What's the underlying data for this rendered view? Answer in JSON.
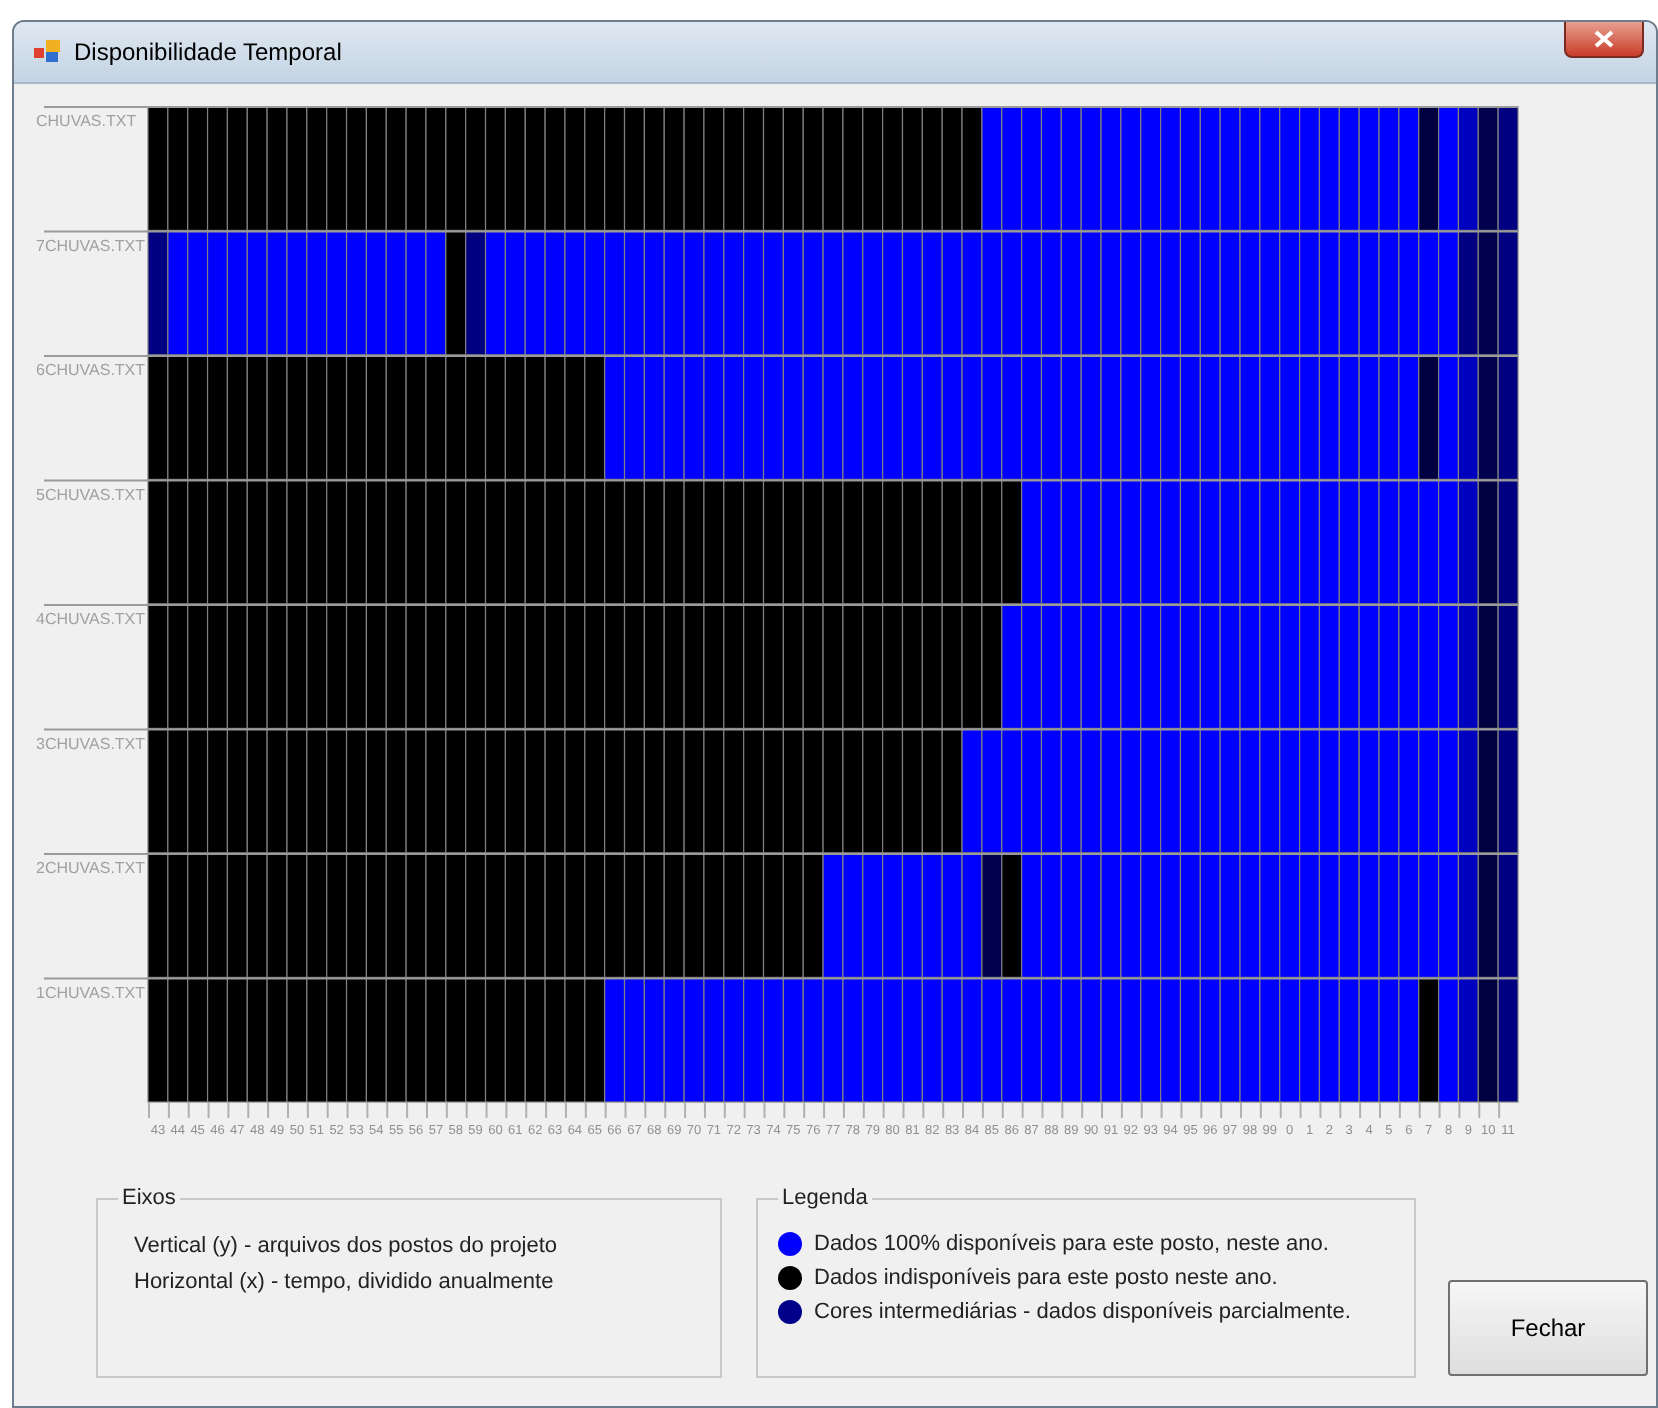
{
  "window": {
    "title": "Disponibilidade Temporal"
  },
  "grid": {
    "year_labels": [
      "43",
      "44",
      "45",
      "46",
      "47",
      "48",
      "49",
      "50",
      "51",
      "52",
      "53",
      "54",
      "55",
      "56",
      "57",
      "58",
      "59",
      "60",
      "61",
      "62",
      "63",
      "64",
      "65",
      "66",
      "67",
      "68",
      "69",
      "70",
      "71",
      "72",
      "73",
      "74",
      "75",
      "76",
      "77",
      "78",
      "79",
      "80",
      "81",
      "82",
      "83",
      "84",
      "85",
      "86",
      "87",
      "88",
      "89",
      "90",
      "91",
      "92",
      "93",
      "94",
      "95",
      "96",
      "97",
      "98",
      "99",
      "0",
      "1",
      "2",
      "3",
      "4",
      "5",
      "6",
      "7",
      "8",
      "9",
      "10",
      "11"
    ],
    "rows": [
      {
        "label": "CHUVAS.TXT",
        "cells": [
          {
            "color": "#000000"
          },
          {
            "color": "#000000"
          },
          {
            "color": "#000000"
          },
          {
            "color": "#000000"
          },
          {
            "color": "#000000"
          },
          {
            "color": "#000000"
          },
          {
            "color": "#000000"
          },
          {
            "color": "#000000"
          },
          {
            "color": "#000000"
          },
          {
            "color": "#000000"
          },
          {
            "color": "#000000"
          },
          {
            "color": "#000000"
          },
          {
            "color": "#000000"
          },
          {
            "color": "#000000"
          },
          {
            "color": "#000000"
          },
          {
            "color": "#000000"
          },
          {
            "color": "#000000"
          },
          {
            "color": "#000000"
          },
          {
            "color": "#000000"
          },
          {
            "color": "#000000"
          },
          {
            "color": "#000000"
          },
          {
            "color": "#000000"
          },
          {
            "color": "#000000"
          },
          {
            "color": "#000000"
          },
          {
            "color": "#000000"
          },
          {
            "color": "#000000"
          },
          {
            "color": "#000000"
          },
          {
            "color": "#000000"
          },
          {
            "color": "#000000"
          },
          {
            "color": "#000000"
          },
          {
            "color": "#000000"
          },
          {
            "color": "#000000"
          },
          {
            "color": "#000000"
          },
          {
            "color": "#000000"
          },
          {
            "color": "#000000"
          },
          {
            "color": "#000000"
          },
          {
            "color": "#000000"
          },
          {
            "color": "#000000"
          },
          {
            "color": "#000000"
          },
          {
            "color": "#000000"
          },
          {
            "color": "#000000"
          },
          {
            "color": "#000000"
          },
          {
            "color": "#0000ff"
          },
          {
            "color": "#0000ff"
          },
          {
            "color": "#0000ff"
          },
          {
            "color": "#0000ff"
          },
          {
            "color": "#0000ff"
          },
          {
            "color": "#0000ff"
          },
          {
            "color": "#0000ff"
          },
          {
            "color": "#0000ff"
          },
          {
            "color": "#0000ff"
          },
          {
            "color": "#0000ff"
          },
          {
            "color": "#0000ff"
          },
          {
            "color": "#0000ff"
          },
          {
            "color": "#0000ff"
          },
          {
            "color": "#0000ff"
          },
          {
            "color": "#0000ff"
          },
          {
            "color": "#0000ff"
          },
          {
            "color": "#0000ff"
          },
          {
            "color": "#0000ff"
          },
          {
            "color": "#0000ff"
          },
          {
            "color": "#0000ff"
          },
          {
            "color": "#0000ff"
          },
          {
            "color": "#0000ff"
          },
          {
            "color": "#000040"
          },
          {
            "color": "#0000ff"
          },
          {
            "color": "#0000bf"
          },
          {
            "color": "#00004d"
          },
          {
            "color": "#000080"
          }
        ]
      },
      {
        "label": "7CHUVAS.TXT",
        "cells": [
          {
            "color": "#000080"
          },
          {
            "color": "#0000ff"
          },
          {
            "color": "#0000ff"
          },
          {
            "color": "#0000ff"
          },
          {
            "color": "#0000ff"
          },
          {
            "color": "#0000ff"
          },
          {
            "color": "#0000ff"
          },
          {
            "color": "#0000ff"
          },
          {
            "color": "#0000ff"
          },
          {
            "color": "#0000ff"
          },
          {
            "color": "#0000ff"
          },
          {
            "color": "#0000ff"
          },
          {
            "color": "#0000ff"
          },
          {
            "color": "#0000ff"
          },
          {
            "color": "#0000ff"
          },
          {
            "color": "#000000"
          },
          {
            "color": "#000080"
          },
          {
            "color": "#0000ff"
          },
          {
            "color": "#0000ff"
          },
          {
            "color": "#0000ff"
          },
          {
            "color": "#0000ff"
          },
          {
            "color": "#0000ff"
          },
          {
            "color": "#0000ff"
          },
          {
            "color": "#0000ff"
          },
          {
            "color": "#0000ff"
          },
          {
            "color": "#0000ff"
          },
          {
            "color": "#0000ff"
          },
          {
            "color": "#0000ff"
          },
          {
            "color": "#0000ff"
          },
          {
            "color": "#0000ff"
          },
          {
            "color": "#0000ff"
          },
          {
            "color": "#0000ff"
          },
          {
            "color": "#0000ff"
          },
          {
            "color": "#0000ff"
          },
          {
            "color": "#0000ff"
          },
          {
            "color": "#0000ff"
          },
          {
            "color": "#0000ff"
          },
          {
            "color": "#0000ff"
          },
          {
            "color": "#0000ff"
          },
          {
            "color": "#0000ff"
          },
          {
            "color": "#0000ff"
          },
          {
            "color": "#0000ff"
          },
          {
            "color": "#0000ff"
          },
          {
            "color": "#0000ff"
          },
          {
            "color": "#0000ff"
          },
          {
            "color": "#0000ff"
          },
          {
            "color": "#0000ff"
          },
          {
            "color": "#0000ff"
          },
          {
            "color": "#0000ff"
          },
          {
            "color": "#0000ff"
          },
          {
            "color": "#0000ff"
          },
          {
            "color": "#0000ff"
          },
          {
            "color": "#0000ff"
          },
          {
            "color": "#0000ff"
          },
          {
            "color": "#0000ff"
          },
          {
            "color": "#0000ff"
          },
          {
            "color": "#0000ff"
          },
          {
            "color": "#0000ff"
          },
          {
            "color": "#0000ff"
          },
          {
            "color": "#0000ff"
          },
          {
            "color": "#0000ff"
          },
          {
            "color": "#0000ff"
          },
          {
            "color": "#0000ff"
          },
          {
            "color": "#0000ff"
          },
          {
            "color": "#0000ff"
          },
          {
            "color": "#0000ff"
          },
          {
            "color": "#000080"
          },
          {
            "color": "#00004d"
          },
          {
            "color": "#000080"
          }
        ]
      },
      {
        "label": "6CHUVAS.TXT",
        "cells": [
          {
            "color": "#000000"
          },
          {
            "color": "#000000"
          },
          {
            "color": "#000000"
          },
          {
            "color": "#000000"
          },
          {
            "color": "#000000"
          },
          {
            "color": "#000000"
          },
          {
            "color": "#000000"
          },
          {
            "color": "#000000"
          },
          {
            "color": "#000000"
          },
          {
            "color": "#000000"
          },
          {
            "color": "#000000"
          },
          {
            "color": "#000000"
          },
          {
            "color": "#000000"
          },
          {
            "color": "#000000"
          },
          {
            "color": "#000000"
          },
          {
            "color": "#000000"
          },
          {
            "color": "#000000"
          },
          {
            "color": "#000000"
          },
          {
            "color": "#000000"
          },
          {
            "color": "#000000"
          },
          {
            "color": "#000000"
          },
          {
            "color": "#000000"
          },
          {
            "color": "#000000"
          },
          {
            "color": "#0000ff"
          },
          {
            "color": "#0000ff"
          },
          {
            "color": "#0000ff"
          },
          {
            "color": "#0000ff"
          },
          {
            "color": "#0000ff"
          },
          {
            "color": "#0000ff"
          },
          {
            "color": "#0000ff"
          },
          {
            "color": "#0000ff"
          },
          {
            "color": "#0000ff"
          },
          {
            "color": "#0000ff"
          },
          {
            "color": "#0000ff"
          },
          {
            "color": "#0000ff"
          },
          {
            "color": "#0000ff"
          },
          {
            "color": "#0000ff"
          },
          {
            "color": "#0000ff"
          },
          {
            "color": "#0000ff"
          },
          {
            "color": "#0000ff"
          },
          {
            "color": "#0000ff"
          },
          {
            "color": "#0000ff"
          },
          {
            "color": "#0000ff"
          },
          {
            "color": "#0000ff"
          },
          {
            "color": "#0000ff"
          },
          {
            "color": "#0000ff"
          },
          {
            "color": "#0000ff"
          },
          {
            "color": "#0000ff"
          },
          {
            "color": "#0000ff"
          },
          {
            "color": "#0000ff"
          },
          {
            "color": "#0000ff"
          },
          {
            "color": "#0000ff"
          },
          {
            "color": "#0000ff"
          },
          {
            "color": "#0000ff"
          },
          {
            "color": "#0000ff"
          },
          {
            "color": "#0000ff"
          },
          {
            "color": "#0000ff"
          },
          {
            "color": "#0000ff"
          },
          {
            "color": "#0000ff"
          },
          {
            "color": "#0000ff"
          },
          {
            "color": "#0000ff"
          },
          {
            "color": "#0000ff"
          },
          {
            "color": "#0000ff"
          },
          {
            "color": "#0000ff"
          },
          {
            "color": "#000040"
          },
          {
            "color": "#0000ff"
          },
          {
            "color": "#0000bf"
          },
          {
            "color": "#00004d"
          },
          {
            "color": "#000080"
          }
        ]
      },
      {
        "label": "5CHUVAS.TXT",
        "cells": [
          {
            "color": "#000000"
          },
          {
            "color": "#000000"
          },
          {
            "color": "#000000"
          },
          {
            "color": "#000000"
          },
          {
            "color": "#000000"
          },
          {
            "color": "#000000"
          },
          {
            "color": "#000000"
          },
          {
            "color": "#000000"
          },
          {
            "color": "#000000"
          },
          {
            "color": "#000000"
          },
          {
            "color": "#000000"
          },
          {
            "color": "#000000"
          },
          {
            "color": "#000000"
          },
          {
            "color": "#000000"
          },
          {
            "color": "#000000"
          },
          {
            "color": "#000000"
          },
          {
            "color": "#000000"
          },
          {
            "color": "#000000"
          },
          {
            "color": "#000000"
          },
          {
            "color": "#000000"
          },
          {
            "color": "#000000"
          },
          {
            "color": "#000000"
          },
          {
            "color": "#000000"
          },
          {
            "color": "#000000"
          },
          {
            "color": "#000000"
          },
          {
            "color": "#000000"
          },
          {
            "color": "#000000"
          },
          {
            "color": "#000000"
          },
          {
            "color": "#000000"
          },
          {
            "color": "#000000"
          },
          {
            "color": "#000000"
          },
          {
            "color": "#000000"
          },
          {
            "color": "#000000"
          },
          {
            "color": "#000000"
          },
          {
            "color": "#000000"
          },
          {
            "color": "#000000"
          },
          {
            "color": "#000000"
          },
          {
            "color": "#000000"
          },
          {
            "color": "#000000"
          },
          {
            "color": "#000000"
          },
          {
            "color": "#000000"
          },
          {
            "color": "#000000"
          },
          {
            "color": "#000000"
          },
          {
            "color": "#000000"
          },
          {
            "color": "#0000ff"
          },
          {
            "color": "#0000ff"
          },
          {
            "color": "#0000ff"
          },
          {
            "color": "#0000ff"
          },
          {
            "color": "#0000ff"
          },
          {
            "color": "#0000ff"
          },
          {
            "color": "#0000ff"
          },
          {
            "color": "#0000ff"
          },
          {
            "color": "#0000ff"
          },
          {
            "color": "#0000ff"
          },
          {
            "color": "#0000ff"
          },
          {
            "color": "#0000ff"
          },
          {
            "color": "#0000ff"
          },
          {
            "color": "#0000ff"
          },
          {
            "color": "#0000ff"
          },
          {
            "color": "#0000ff"
          },
          {
            "color": "#0000ff"
          },
          {
            "color": "#0000ff"
          },
          {
            "color": "#0000ff"
          },
          {
            "color": "#0000ff"
          },
          {
            "color": "#0000ff"
          },
          {
            "color": "#0000ff"
          },
          {
            "color": "#0000bf"
          },
          {
            "color": "#000040"
          },
          {
            "color": "#000080"
          }
        ]
      },
      {
        "label": "4CHUVAS.TXT",
        "cells": [
          {
            "color": "#000000"
          },
          {
            "color": "#000000"
          },
          {
            "color": "#000000"
          },
          {
            "color": "#000000"
          },
          {
            "color": "#000000"
          },
          {
            "color": "#000000"
          },
          {
            "color": "#000000"
          },
          {
            "color": "#000000"
          },
          {
            "color": "#000000"
          },
          {
            "color": "#000000"
          },
          {
            "color": "#000000"
          },
          {
            "color": "#000000"
          },
          {
            "color": "#000000"
          },
          {
            "color": "#000000"
          },
          {
            "color": "#000000"
          },
          {
            "color": "#000000"
          },
          {
            "color": "#000000"
          },
          {
            "color": "#000000"
          },
          {
            "color": "#000000"
          },
          {
            "color": "#000000"
          },
          {
            "color": "#000000"
          },
          {
            "color": "#000000"
          },
          {
            "color": "#000000"
          },
          {
            "color": "#000000"
          },
          {
            "color": "#000000"
          },
          {
            "color": "#000000"
          },
          {
            "color": "#000000"
          },
          {
            "color": "#000000"
          },
          {
            "color": "#000000"
          },
          {
            "color": "#000000"
          },
          {
            "color": "#000000"
          },
          {
            "color": "#000000"
          },
          {
            "color": "#000000"
          },
          {
            "color": "#000000"
          },
          {
            "color": "#000000"
          },
          {
            "color": "#000000"
          },
          {
            "color": "#000000"
          },
          {
            "color": "#000000"
          },
          {
            "color": "#000000"
          },
          {
            "color": "#000000"
          },
          {
            "color": "#000000"
          },
          {
            "color": "#000000"
          },
          {
            "color": "#000000"
          },
          {
            "color": "#0000ff"
          },
          {
            "color": "#0000ff"
          },
          {
            "color": "#0000ff"
          },
          {
            "color": "#0000ff"
          },
          {
            "color": "#0000ff"
          },
          {
            "color": "#0000ff"
          },
          {
            "color": "#0000ff"
          },
          {
            "color": "#0000ff"
          },
          {
            "color": "#0000ff"
          },
          {
            "color": "#0000ff"
          },
          {
            "color": "#0000ff"
          },
          {
            "color": "#0000ff"
          },
          {
            "color": "#0000ff"
          },
          {
            "color": "#0000ff"
          },
          {
            "color": "#0000ff"
          },
          {
            "color": "#0000ff"
          },
          {
            "color": "#0000ff"
          },
          {
            "color": "#0000ff"
          },
          {
            "color": "#0000ff"
          },
          {
            "color": "#0000ff"
          },
          {
            "color": "#0000ff"
          },
          {
            "color": "#0000ff"
          },
          {
            "color": "#0000ff"
          },
          {
            "color": "#0000bf"
          },
          {
            "color": "#000040"
          },
          {
            "color": "#000080"
          }
        ]
      },
      {
        "label": "3CHUVAS.TXT",
        "cells": [
          {
            "color": "#000000"
          },
          {
            "color": "#000000"
          },
          {
            "color": "#000000"
          },
          {
            "color": "#000000"
          },
          {
            "color": "#000000"
          },
          {
            "color": "#000000"
          },
          {
            "color": "#000000"
          },
          {
            "color": "#000000"
          },
          {
            "color": "#000000"
          },
          {
            "color": "#000000"
          },
          {
            "color": "#000000"
          },
          {
            "color": "#000000"
          },
          {
            "color": "#000000"
          },
          {
            "color": "#000000"
          },
          {
            "color": "#000000"
          },
          {
            "color": "#000000"
          },
          {
            "color": "#000000"
          },
          {
            "color": "#000000"
          },
          {
            "color": "#000000"
          },
          {
            "color": "#000000"
          },
          {
            "color": "#000000"
          },
          {
            "color": "#000000"
          },
          {
            "color": "#000000"
          },
          {
            "color": "#000000"
          },
          {
            "color": "#000000"
          },
          {
            "color": "#000000"
          },
          {
            "color": "#000000"
          },
          {
            "color": "#000000"
          },
          {
            "color": "#000000"
          },
          {
            "color": "#000000"
          },
          {
            "color": "#000000"
          },
          {
            "color": "#000000"
          },
          {
            "color": "#000000"
          },
          {
            "color": "#000000"
          },
          {
            "color": "#000000"
          },
          {
            "color": "#000000"
          },
          {
            "color": "#000000"
          },
          {
            "color": "#000000"
          },
          {
            "color": "#000000"
          },
          {
            "color": "#000000"
          },
          {
            "color": "#000000"
          },
          {
            "color": "#0000ff"
          },
          {
            "color": "#0000ff"
          },
          {
            "color": "#0000ff"
          },
          {
            "color": "#0000ff"
          },
          {
            "color": "#0000ff"
          },
          {
            "color": "#0000ff"
          },
          {
            "color": "#0000ff"
          },
          {
            "color": "#0000ff"
          },
          {
            "color": "#0000ff"
          },
          {
            "color": "#0000ff"
          },
          {
            "color": "#0000ff"
          },
          {
            "color": "#0000ff"
          },
          {
            "color": "#0000ff"
          },
          {
            "color": "#0000ff"
          },
          {
            "color": "#0000ff"
          },
          {
            "color": "#0000ff"
          },
          {
            "color": "#0000ff"
          },
          {
            "color": "#0000ff"
          },
          {
            "color": "#0000ff"
          },
          {
            "color": "#0000ff"
          },
          {
            "color": "#0000ff"
          },
          {
            "color": "#0000ff"
          },
          {
            "color": "#0000ff"
          },
          {
            "color": "#0000ff"
          },
          {
            "color": "#0000ff"
          },
          {
            "color": "#0000bf"
          },
          {
            "color": "#000040"
          },
          {
            "color": "#000080"
          }
        ]
      },
      {
        "label": "2CHUVAS.TXT",
        "cells": [
          {
            "color": "#000000"
          },
          {
            "color": "#000000"
          },
          {
            "color": "#000000"
          },
          {
            "color": "#000000"
          },
          {
            "color": "#000000"
          },
          {
            "color": "#000000"
          },
          {
            "color": "#000000"
          },
          {
            "color": "#000000"
          },
          {
            "color": "#000000"
          },
          {
            "color": "#000000"
          },
          {
            "color": "#000000"
          },
          {
            "color": "#000000"
          },
          {
            "color": "#000000"
          },
          {
            "color": "#000000"
          },
          {
            "color": "#000000"
          },
          {
            "color": "#000000"
          },
          {
            "color": "#000000"
          },
          {
            "color": "#000000"
          },
          {
            "color": "#000000"
          },
          {
            "color": "#000000"
          },
          {
            "color": "#000000"
          },
          {
            "color": "#000000"
          },
          {
            "color": "#000000"
          },
          {
            "color": "#000000"
          },
          {
            "color": "#000000"
          },
          {
            "color": "#000000"
          },
          {
            "color": "#000000"
          },
          {
            "color": "#000000"
          },
          {
            "color": "#000000"
          },
          {
            "color": "#000000"
          },
          {
            "color": "#000000"
          },
          {
            "color": "#000000"
          },
          {
            "color": "#000000"
          },
          {
            "color": "#000000"
          },
          {
            "color": "#0000ff"
          },
          {
            "color": "#0000ff"
          },
          {
            "color": "#0000ff"
          },
          {
            "color": "#0000ff"
          },
          {
            "color": "#0000ff"
          },
          {
            "color": "#0000ff"
          },
          {
            "color": "#0000ff"
          },
          {
            "color": "#0000ff"
          },
          {
            "color": "#00004d"
          },
          {
            "color": "#000000"
          },
          {
            "color": "#0000ff"
          },
          {
            "color": "#0000ff"
          },
          {
            "color": "#0000ff"
          },
          {
            "color": "#0000ff"
          },
          {
            "color": "#0000ff"
          },
          {
            "color": "#0000ff"
          },
          {
            "color": "#0000ff"
          },
          {
            "color": "#0000ff"
          },
          {
            "color": "#0000ff"
          },
          {
            "color": "#0000ff"
          },
          {
            "color": "#0000ff"
          },
          {
            "color": "#0000ff"
          },
          {
            "color": "#0000ff"
          },
          {
            "color": "#0000ff"
          },
          {
            "color": "#0000ff"
          },
          {
            "color": "#0000ff"
          },
          {
            "color": "#0000ff"
          },
          {
            "color": "#0000ff"
          },
          {
            "color": "#0000ff"
          },
          {
            "color": "#0000ff"
          },
          {
            "color": "#0000ff"
          },
          {
            "color": "#0000ff"
          },
          {
            "color": "#0000bf"
          },
          {
            "color": "#000040"
          },
          {
            "color": "#000080"
          }
        ]
      },
      {
        "label": "1CHUVAS.TXT",
        "cells": [
          {
            "color": "#000000"
          },
          {
            "color": "#000000"
          },
          {
            "color": "#000000"
          },
          {
            "color": "#000000"
          },
          {
            "color": "#000000"
          },
          {
            "color": "#000000"
          },
          {
            "color": "#000000"
          },
          {
            "color": "#000000"
          },
          {
            "color": "#000000"
          },
          {
            "color": "#000000"
          },
          {
            "color": "#000000"
          },
          {
            "color": "#000000"
          },
          {
            "color": "#000000"
          },
          {
            "color": "#000000"
          },
          {
            "color": "#000000"
          },
          {
            "color": "#000000"
          },
          {
            "color": "#000000"
          },
          {
            "color": "#000000"
          },
          {
            "color": "#000000"
          },
          {
            "color": "#000000"
          },
          {
            "color": "#000000"
          },
          {
            "color": "#000000"
          },
          {
            "color": "#000000"
          },
          {
            "color": "#0000ff"
          },
          {
            "color": "#0000ff"
          },
          {
            "color": "#0000ff"
          },
          {
            "color": "#0000ff"
          },
          {
            "color": "#0000ff"
          },
          {
            "color": "#0000ff"
          },
          {
            "color": "#0000ff"
          },
          {
            "color": "#0000ff"
          },
          {
            "color": "#0000ff"
          },
          {
            "color": "#0000ff"
          },
          {
            "color": "#0000ff"
          },
          {
            "color": "#0000ff"
          },
          {
            "color": "#0000ff"
          },
          {
            "color": "#0000ff"
          },
          {
            "color": "#0000ff"
          },
          {
            "color": "#0000ff"
          },
          {
            "color": "#0000ff"
          },
          {
            "color": "#0000ff"
          },
          {
            "color": "#0000ff"
          },
          {
            "color": "#0000ff"
          },
          {
            "color": "#0000ff"
          },
          {
            "color": "#0000ff"
          },
          {
            "color": "#0000ff"
          },
          {
            "color": "#0000ff"
          },
          {
            "color": "#0000ff"
          },
          {
            "color": "#0000ff"
          },
          {
            "color": "#0000ff"
          },
          {
            "color": "#0000ff"
          },
          {
            "color": "#0000ff"
          },
          {
            "color": "#0000ff"
          },
          {
            "color": "#0000ff"
          },
          {
            "color": "#0000ff"
          },
          {
            "color": "#0000ff"
          },
          {
            "color": "#0000ff"
          },
          {
            "color": "#0000ff"
          },
          {
            "color": "#0000ff"
          },
          {
            "color": "#0000ff"
          },
          {
            "color": "#0000ff"
          },
          {
            "color": "#0000ff"
          },
          {
            "color": "#0000ff"
          },
          {
            "color": "#0000ff"
          },
          {
            "color": "#000000"
          },
          {
            "color": "#0000ff"
          },
          {
            "color": "#0000bf"
          },
          {
            "color": "#000040"
          },
          {
            "color": "#000080"
          }
        ]
      }
    ]
  },
  "axes_group": {
    "title": "Eixos",
    "lines": [
      "Vertical (y) - arquivos dos postos do projeto",
      "Horizontal (x) - tempo, dividido anualmente"
    ]
  },
  "legend_group": {
    "title": "Legenda",
    "items": [
      {
        "color": "#0000ff",
        "text": "Dados 100% disponíveis para este posto, neste ano."
      },
      {
        "color": "#000000",
        "text": "Dados indisponíveis para este posto neste ano."
      },
      {
        "color": "#00008b",
        "text": "Cores intermediárias - dados disponíveis parcialmente."
      }
    ]
  },
  "buttons": [
    "Fechar"
  ]
}
